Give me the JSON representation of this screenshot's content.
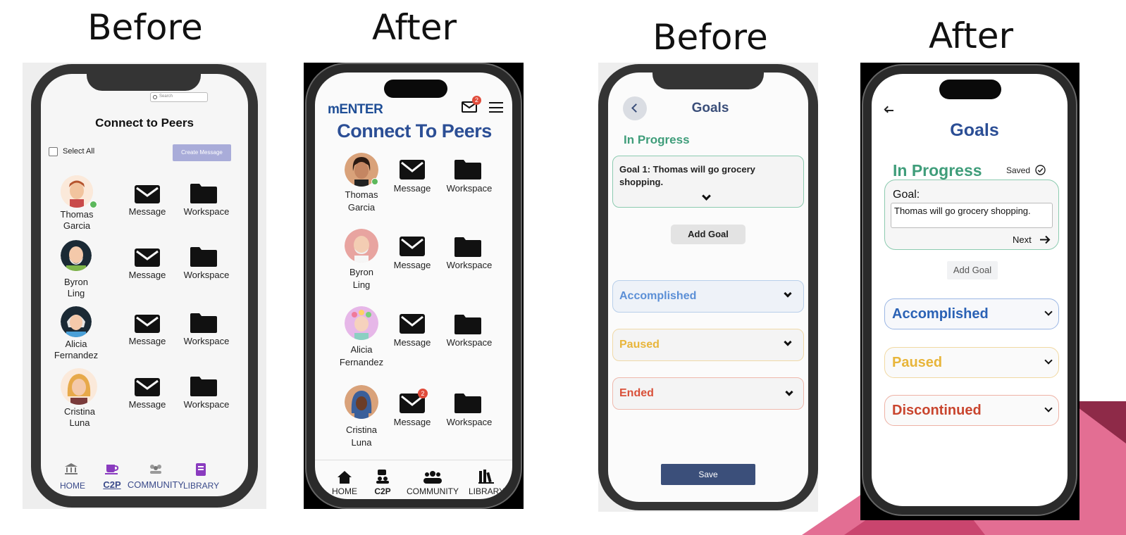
{
  "headings": {
    "before1": "Before",
    "after1": "After",
    "before2": "Before",
    "after2": "After"
  },
  "colors": {
    "navy": "#1f4e96",
    "green": "#3f9d7a",
    "blue": "#5b8fd6",
    "yellow": "#e8b53a",
    "red": "#d9513a",
    "save": "#3b4f7a",
    "pink": "#e0628a"
  },
  "phone1": {
    "search_placeholder": "Search",
    "title": "Connect to Peers",
    "select_all": "Select All",
    "create_message": "Create Message",
    "peers": [
      {
        "first": "Thomas",
        "last": "Garcia"
      },
      {
        "first": "Byron",
        "last": "Ling"
      },
      {
        "first": "Alicia",
        "last": "Fernandez"
      },
      {
        "first": "Cristina",
        "last": "Luna"
      }
    ],
    "message_label": "Message",
    "workspace_label": "Workspace",
    "nav": [
      "HOME",
      "C2P",
      "COMMUNITY",
      "LIBRARY"
    ]
  },
  "phone2": {
    "brand": "mENTER",
    "mail_badge": "2",
    "title": "Connect To Peers",
    "peers": [
      {
        "first": "Thomas",
        "last": "Garcia"
      },
      {
        "first": "Byron",
        "last": "Ling"
      },
      {
        "first": "Alicia",
        "last": "Fernandez"
      },
      {
        "first": "Cristina",
        "last": "Luna"
      }
    ],
    "message_label": "Message",
    "workspace_label": "Workspace",
    "message_badge": "2",
    "nav": [
      "HOME",
      "C2P",
      "COMMUNITY",
      "LIBRARY"
    ]
  },
  "phone3": {
    "title": "Goals",
    "in_progress": "In Progress",
    "goal_text": "Goal 1: Thomas will go grocery shopping.",
    "add_goal": "Add Goal",
    "accomplished": "Accomplished",
    "paused": "Paused",
    "ended": "Ended",
    "save": "Save"
  },
  "phone4": {
    "title": "Goals",
    "in_progress": "In Progress",
    "saved": "Saved",
    "goal_label": "Goal:",
    "goal_value": "Thomas will go grocery shopping.",
    "next": "Next",
    "add_goal": "Add Goal",
    "accomplished": "Accomplished",
    "paused": "Paused",
    "discontinued": "Discontinued"
  }
}
